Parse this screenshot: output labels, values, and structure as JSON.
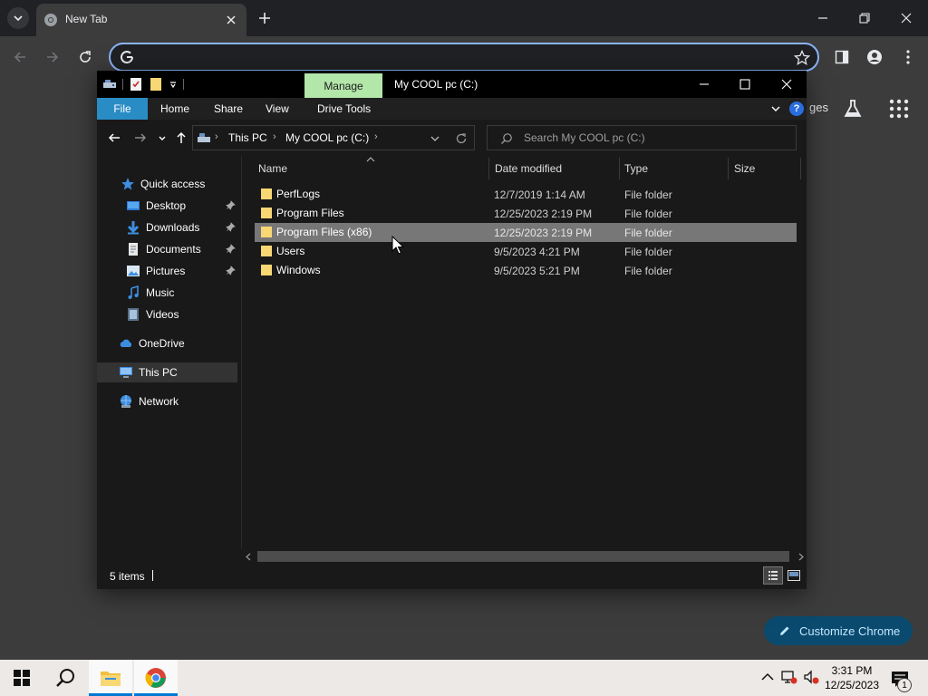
{
  "chrome": {
    "tab_title": "New Tab",
    "omnibox_value": "",
    "ntp_fragment": "ges",
    "customize_label": "Customize Chrome"
  },
  "explorer": {
    "title": "My COOL pc (C:)",
    "ribbon": {
      "manage": "Manage",
      "tabs": [
        "File",
        "Home",
        "Share",
        "View",
        "Drive Tools"
      ]
    },
    "breadcrumb": [
      "This PC",
      "My COOL pc (C:)"
    ],
    "search_placeholder": "Search My COOL pc (C:)",
    "nav": {
      "quick_access": "Quick access",
      "quick_items": [
        {
          "label": "Desktop",
          "icon": "desktop-icon",
          "pinned": true
        },
        {
          "label": "Downloads",
          "icon": "downloads-icon",
          "pinned": true
        },
        {
          "label": "Documents",
          "icon": "documents-icon",
          "pinned": true
        },
        {
          "label": "Pictures",
          "icon": "pictures-icon",
          "pinned": true
        },
        {
          "label": "Music",
          "icon": "music-icon",
          "pinned": false
        },
        {
          "label": "Videos",
          "icon": "videos-icon",
          "pinned": false
        }
      ],
      "onedrive": "OneDrive",
      "this_pc": "This PC",
      "network": "Network"
    },
    "columns": [
      "Name",
      "Date modified",
      "Type",
      "Size"
    ],
    "files": [
      {
        "name": "PerfLogs",
        "date": "12/7/2019 1:14 AM",
        "type": "File folder"
      },
      {
        "name": "Program Files",
        "date": "12/25/2023 2:19 PM",
        "type": "File folder"
      },
      {
        "name": "Program Files (x86)",
        "date": "12/25/2023 2:19 PM",
        "type": "File folder"
      },
      {
        "name": "Users",
        "date": "9/5/2023 4:21 PM",
        "type": "File folder"
      },
      {
        "name": "Windows",
        "date": "9/5/2023 5:21 PM",
        "type": "File folder"
      }
    ],
    "status": "5 items"
  },
  "taskbar": {
    "time": "3:31 PM",
    "date": "12/25/2023",
    "notification_count": "1"
  },
  "colors": {
    "accent": "#0078d4",
    "manage_tab": "#b3e6a9",
    "file_tab": "#2a8cc4",
    "folder": "#f8d775",
    "customize_bg": "#0a4a6e"
  }
}
